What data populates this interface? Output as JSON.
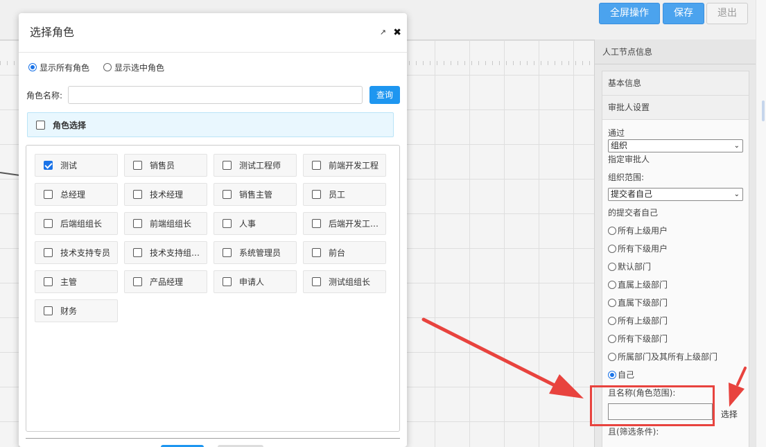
{
  "toolbar": {
    "fullscreen_label": "全屏操作",
    "save_label": "保存",
    "exit_label": "退出"
  },
  "panel": {
    "title": "人工节点信息",
    "section_basic": "基本信息",
    "section_approver": "审批人设置",
    "pass_label": "通过",
    "pass_select": "组织",
    "assign_label": "指定审批人",
    "org_scope_label": "组织范围:",
    "org_scope_select": "提交者自己",
    "submitter_label": "的提交者自己",
    "radio_options": [
      {
        "label": "所有上级用户",
        "checked": false
      },
      {
        "label": "所有下级用户",
        "checked": false
      },
      {
        "label": "默认部门",
        "checked": false
      },
      {
        "label": "直属上级部门",
        "checked": false
      },
      {
        "label": "直属下级部门",
        "checked": false
      },
      {
        "label": "所有上级部门",
        "checked": false
      },
      {
        "label": "所有下级部门",
        "checked": false
      },
      {
        "label": "所属部门及其所有上级部门",
        "checked": false
      },
      {
        "label": "自己",
        "checked": true
      }
    ],
    "role_name_label": "且名称(角色范围):",
    "select_link": "选择",
    "filter_label": "且(筛选条件):"
  },
  "dialog": {
    "title": "选择角色",
    "show_all_label": "显示所有角色",
    "show_selected_label": "显示选中角色",
    "role_name_label": "角色名称:",
    "role_name_value": "",
    "query_label": "查询",
    "role_select_header": "角色选择",
    "roles": [
      {
        "label": "测试",
        "checked": true
      },
      {
        "label": "销售员",
        "checked": false
      },
      {
        "label": "测试工程师",
        "checked": false
      },
      {
        "label": "前端开发工程",
        "checked": false
      },
      {
        "label": "总经理",
        "checked": false
      },
      {
        "label": "技术经理",
        "checked": false
      },
      {
        "label": "销售主管",
        "checked": false
      },
      {
        "label": "员工",
        "checked": false
      },
      {
        "label": "后端组组长",
        "checked": false
      },
      {
        "label": "前端组组长",
        "checked": false
      },
      {
        "label": "人事",
        "checked": false
      },
      {
        "label": "后端开发工…",
        "checked": false
      },
      {
        "label": "技术支持专员",
        "checked": false
      },
      {
        "label": "技术支持组…",
        "checked": false
      },
      {
        "label": "系统管理员",
        "checked": false
      },
      {
        "label": "前台",
        "checked": false
      },
      {
        "label": "主管",
        "checked": false
      },
      {
        "label": "产品经理",
        "checked": false
      },
      {
        "label": "申请人",
        "checked": false
      },
      {
        "label": "测试组组长",
        "checked": false
      },
      {
        "label": "财务",
        "checked": false
      }
    ]
  },
  "colors": {
    "primary": "#1e96f0",
    "highlight": "#e8433e"
  }
}
